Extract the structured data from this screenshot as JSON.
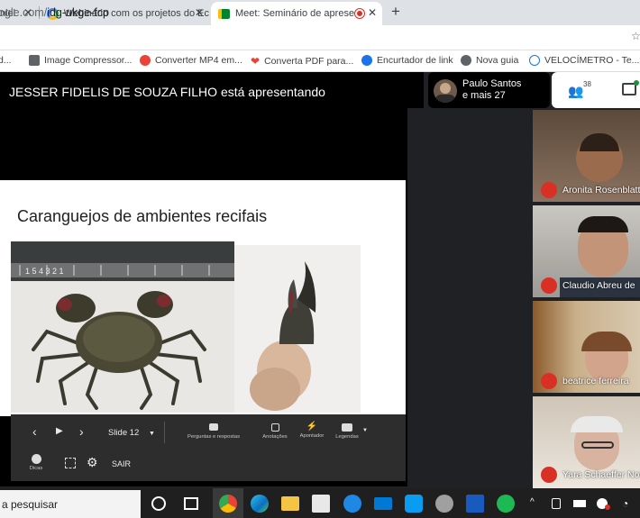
{
  "browser": {
    "tabs": [
      {
        "label": "niel",
        "icon": "page-icon"
      },
      {
        "label": "Webinário com os projetos do Ec",
        "icon": "google-icon"
      },
      {
        "label": "Meet: Seminário de apresent",
        "icon": "meet-icon"
      }
    ],
    "new_tab": "+",
    "url_dim": "ogle.com/",
    "url_main": "idg-ukge-fcp",
    "bookmarks": [
      {
        "label": "d...",
        "icon": "folder-icon"
      },
      {
        "label": "Image Compressor...",
        "icon": "image-icon"
      },
      {
        "label": "Converter MP4 em...",
        "icon": "convert-icon"
      },
      {
        "label": "Converta PDF para...",
        "icon": "heart-icon"
      },
      {
        "label": "Encurtador de link",
        "icon": "link-icon"
      },
      {
        "label": "Nova guia",
        "icon": "globe-icon"
      },
      {
        "label": "VELOCÍMETRO - Te...",
        "icon": "speed-icon"
      }
    ]
  },
  "meet": {
    "presenter_label": "JESSER FIDELIS DE SOUZA FILHO está apresentando",
    "slide_title": "Caranguejos de ambientes recifais",
    "ruler_numbers": "1  5    4    3    2    1",
    "controls": {
      "prev": "‹",
      "play": "▶",
      "next": "›",
      "slide_label": "Slide 12",
      "qa": "Perguntas e respostas",
      "notes": "Anotações",
      "pointer": "Apontador",
      "captions": "Legendas",
      "tips": "Dicas",
      "exit": "SAIR"
    },
    "participants_head": {
      "name": "Paulo Santos",
      "more": "e mais 27"
    },
    "participant_count": "38",
    "tiles": [
      {
        "name": "Aronita Rosenblatt"
      },
      {
        "name": "Claudio Abreu de"
      },
      {
        "name": "beatrice ferreira"
      },
      {
        "name": "Yara Schaeffer Nov"
      }
    ]
  },
  "taskbar": {
    "search_placeholder": "a pesquisar"
  },
  "colors": {
    "accent_red": "#d93025",
    "meet_bg": "#202124"
  }
}
